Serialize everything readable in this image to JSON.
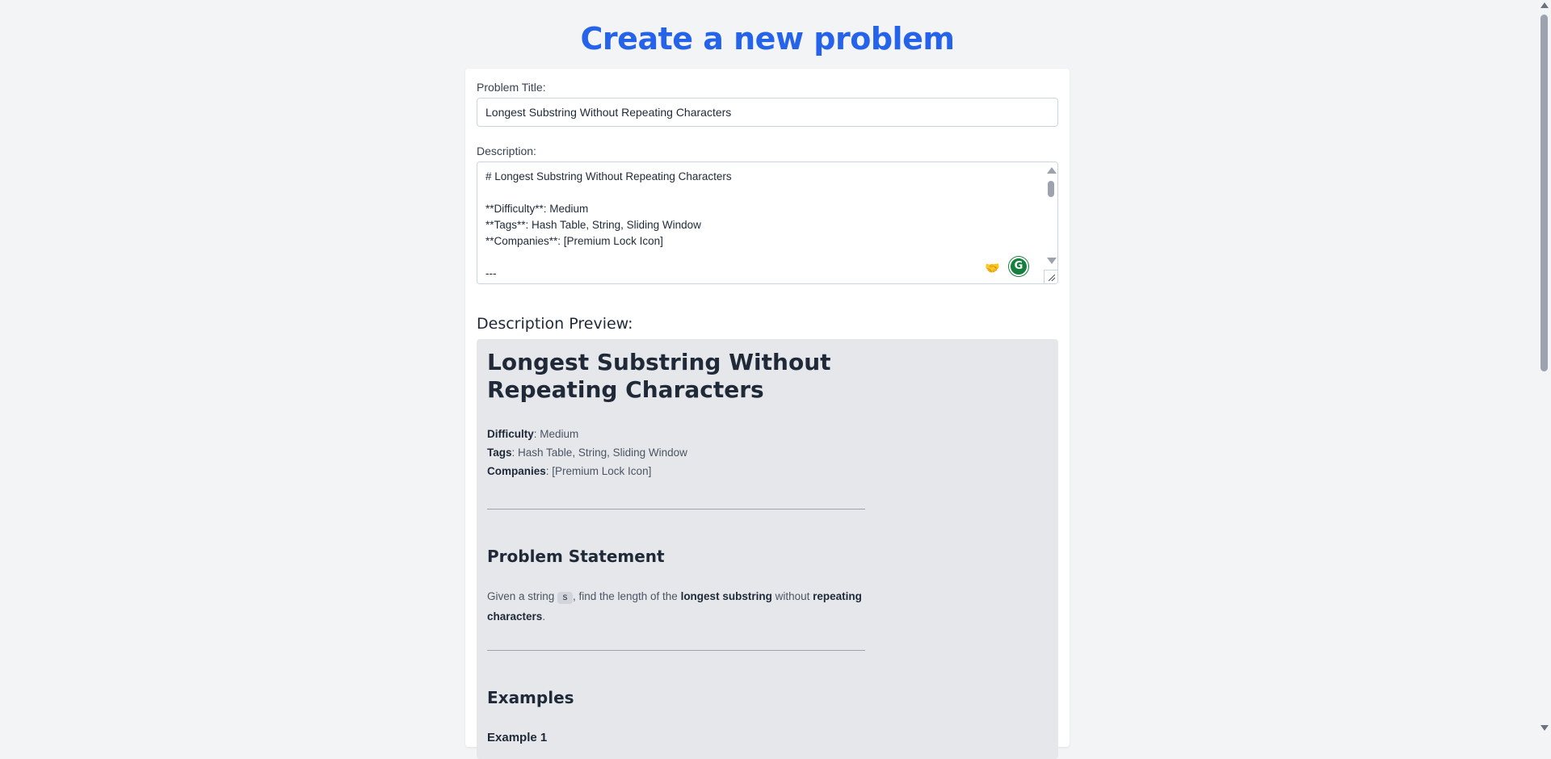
{
  "page": {
    "title": "Create a new problem"
  },
  "form": {
    "title_label": "Problem Title:",
    "title_value": "Longest Substring Without Repeating Characters",
    "description_label": "Description:",
    "description_text": "# Longest Substring Without Repeating Characters\n\n**Difficulty**: Medium\n**Tags**: Hash Table, String, Sliding Window\n**Companies**: [Premium Lock Icon]\n\n---"
  },
  "extensions": [
    {
      "icon": "handshake-icon",
      "glyph": "🤝"
    },
    {
      "icon": "grammarly-icon",
      "glyph": "G"
    }
  ],
  "preview": {
    "heading": "Description Preview:",
    "h1": "Longest Substring Without Repeating Characters",
    "meta": [
      {
        "key": "Difficulty",
        "value": ": Medium"
      },
      {
        "key": "Tags",
        "value": ": Hash Table, String, Sliding Window"
      },
      {
        "key": "Companies",
        "value": ": [Premium Lock Icon]"
      }
    ],
    "problem_statement_heading": "Problem Statement",
    "statement": {
      "part1": "Given a string ",
      "code": "s",
      "part2": ", find the length of the ",
      "bold1": "longest substring",
      "part3": " without ",
      "bold2": "repeating characters",
      "part4": "."
    },
    "examples_heading": "Examples",
    "example_1": "Example 1"
  },
  "colors": {
    "accent": "#2563eb",
    "background": "#f3f4f6",
    "preview_bg": "#e5e7eb"
  }
}
